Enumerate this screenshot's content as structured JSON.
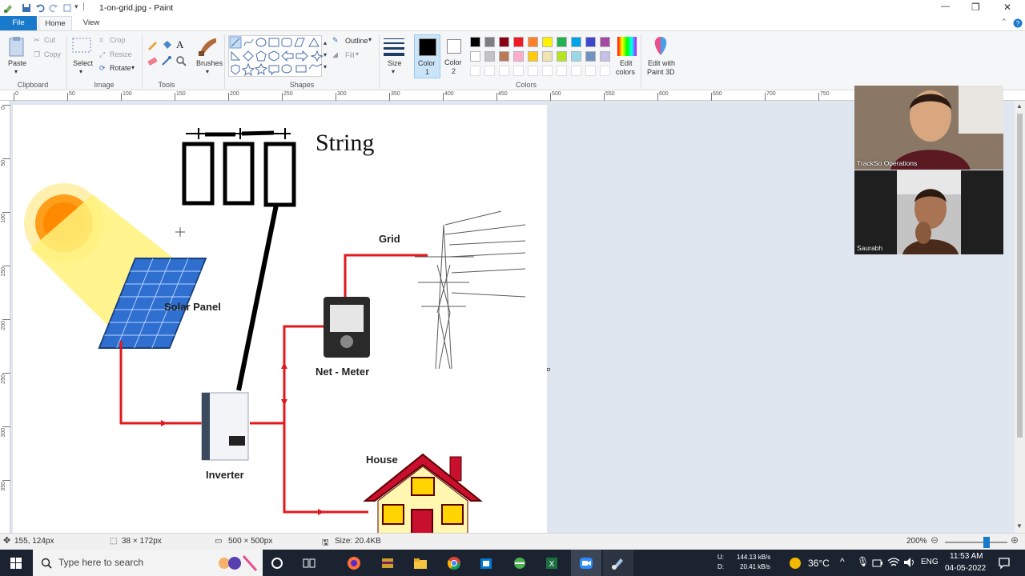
{
  "window": {
    "title": "1-on-grid.jpg - Paint",
    "minimize": "—",
    "maximize": "❐",
    "close": "✕"
  },
  "tabs": {
    "file": "File",
    "home": "Home",
    "view": "View"
  },
  "ribbon": {
    "clipboard": {
      "paste": "Paste",
      "cut": "Cut",
      "copy": "Copy",
      "label": "Clipboard"
    },
    "image": {
      "select": "Select",
      "crop": "Crop",
      "resize": "Resize",
      "rotate": "Rotate",
      "label": "Image"
    },
    "tools": {
      "label": "Tools"
    },
    "brushes": "Brushes",
    "shapes": {
      "outline": "Outline",
      "fill": "Fill",
      "label": "Shapes"
    },
    "size": "Size",
    "color1": [
      "Color",
      "1"
    ],
    "color2": [
      "Color",
      "2"
    ],
    "colors_label": "Colors",
    "edit_colors": [
      "Edit",
      "colors"
    ],
    "edit_paint3d": [
      "Edit with",
      "Paint 3D"
    ],
    "palette_row1": [
      "#000000",
      "#7f7f7f",
      "#880015",
      "#ed1c24",
      "#ff7f27",
      "#fff200",
      "#22b14c",
      "#00a2e8",
      "#3f48cc",
      "#a349a4"
    ],
    "palette_row2": [
      "#ffffff",
      "#c3c3c3",
      "#b97a57",
      "#ffaec9",
      "#ffc90e",
      "#efe4b0",
      "#b5e61d",
      "#99d9ea",
      "#7092be",
      "#c8bfe7"
    ],
    "color1_value": "#000000",
    "color2_value": "#ffffff"
  },
  "ruler_h": [
    "0",
    "50",
    "100",
    "150",
    "200",
    "250",
    "300",
    "350",
    "400",
    "450",
    "500",
    "550",
    "600",
    "650",
    "700",
    "750"
  ],
  "ruler_v": [
    "0",
    "50",
    "100",
    "150",
    "200",
    "250",
    "300",
    "350"
  ],
  "canvas": {
    "string_label": "String",
    "solar_label": "Solar Panel",
    "grid_label": "Grid",
    "netmeter_label": "Net - Meter",
    "inverter_label": "Inverter",
    "house_label": "House"
  },
  "video": {
    "participant1": "TrackSo Operations",
    "participant2": "Saurabh"
  },
  "status": {
    "cursor_pos": "155, 124px",
    "selection_size": "38 × 172px",
    "image_size": "500 × 500px",
    "file_size": "Size: 20.4KB",
    "zoom": "200%"
  },
  "taskbar": {
    "search_placeholder": "Type here to search",
    "net_up_label": "U:",
    "net_up": "144.13 kB/s",
    "net_down_label": "D:",
    "net_down": "20.41 kB/s",
    "temperature": "36°C",
    "language": "ENG",
    "time": "11:53 AM",
    "date": "04-05-2022"
  }
}
